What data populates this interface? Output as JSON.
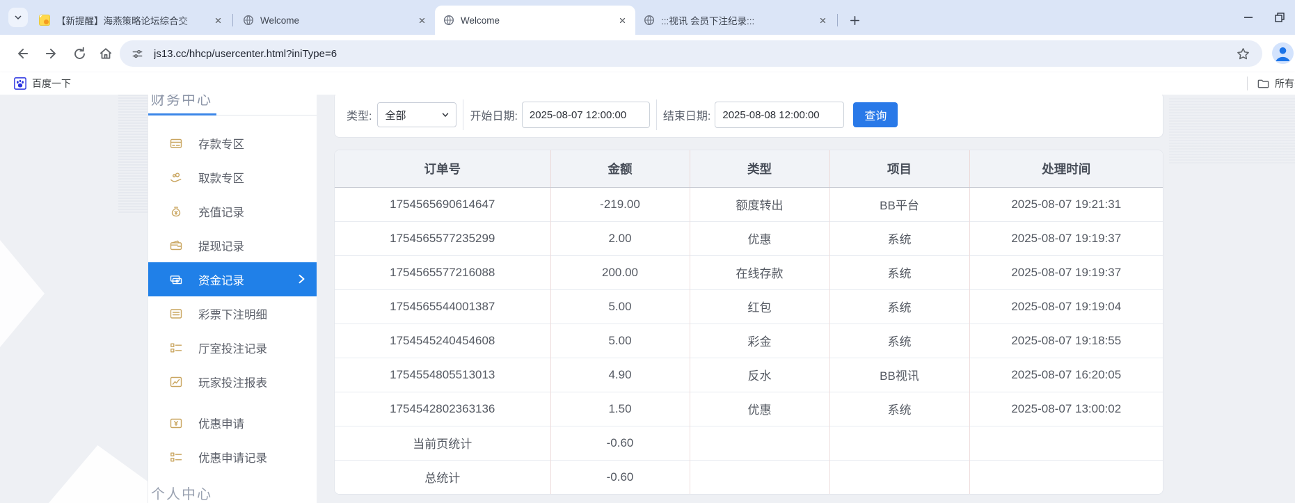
{
  "browser": {
    "tabs": [
      {
        "title": "【新提醒】海燕策略论坛综合交",
        "favicon": "haiyan",
        "active": false
      },
      {
        "title": "Welcome",
        "favicon": "globe",
        "active": false
      },
      {
        "title": "Welcome",
        "favicon": "globe",
        "active": true
      },
      {
        "title": ":::视讯 会员下注纪录:::",
        "favicon": "globe",
        "active": false
      }
    ],
    "address_url": "js13.cc/hhcp/usercenter.html?iniType=6",
    "bookmark_label": "百度一下",
    "bookmarks_overflow_label": "所有书签"
  },
  "sidebar": {
    "top_section_title": "财务中心",
    "bottom_section_title": "个人中心",
    "selected_index": 4,
    "items": [
      {
        "label": "存款专区",
        "icon": "deposit-card"
      },
      {
        "label": "取款专区",
        "icon": "withdraw-hand"
      },
      {
        "label": "充值记录",
        "icon": "moneybag"
      },
      {
        "label": "提现记录",
        "icon": "wallet"
      },
      {
        "label": "资金记录",
        "icon": "banknotes"
      },
      {
        "label": "彩票下注明细",
        "icon": "list-doc"
      },
      {
        "label": "厅室投注记录",
        "icon": "checklist"
      },
      {
        "label": "玩家投注报表",
        "icon": "report-chart"
      },
      {
        "label": "优惠申请",
        "icon": "envelope-yen"
      },
      {
        "label": "优惠申请记录",
        "icon": "checklist"
      }
    ]
  },
  "filter": {
    "type_label": "类型:",
    "type_value": "全部",
    "start_label": "开始日期:",
    "start_value": "2025-08-07 12:00:00",
    "end_label": "结束日期:",
    "end_value": "2025-08-08 12:00:00",
    "query_button": "查询"
  },
  "records_table": {
    "headers": [
      "订单号",
      "金额",
      "类型",
      "项目",
      "处理时间"
    ],
    "rows": [
      [
        "1754565690614647",
        "-219.00",
        "额度转出",
        "BB平台",
        "2025-08-07 19:21:31"
      ],
      [
        "1754565577235299",
        "2.00",
        "优惠",
        "系统",
        "2025-08-07 19:19:37"
      ],
      [
        "1754565577216088",
        "200.00",
        "在线存款",
        "系统",
        "2025-08-07 19:19:37"
      ],
      [
        "1754565544001387",
        "5.00",
        "红包",
        "系统",
        "2025-08-07 19:19:04"
      ],
      [
        "1754545240454608",
        "5.00",
        "彩金",
        "系统",
        "2025-08-07 19:18:55"
      ],
      [
        "1754554805513013",
        "4.90",
        "反水",
        "BB视讯",
        "2025-08-07 16:20:05"
      ],
      [
        "1754542802363136",
        "1.50",
        "优惠",
        "系统",
        "2025-08-07 13:00:02"
      ],
      [
        "当前页统计",
        "-0.60",
        "",
        "",
        ""
      ],
      [
        "总统计",
        "-0.60",
        "",
        "",
        ""
      ]
    ]
  },
  "colors": {
    "accent_blue": "#2080e8",
    "button_blue": "#2979e8",
    "gold_icon": "#c9a55f",
    "tabstrip_bg": "#dbe5f7",
    "table_header_bg": "#f1f3f7",
    "page_bg": "#eef0f4"
  }
}
